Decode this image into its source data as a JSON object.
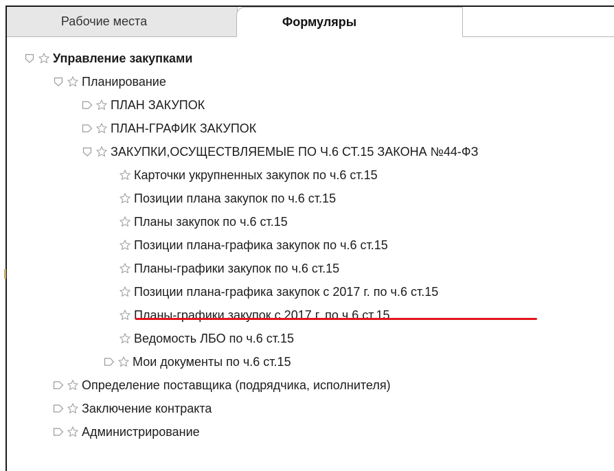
{
  "tabs": [
    {
      "label": "Рабочие места",
      "active": false
    },
    {
      "label": "Формуляры",
      "active": true
    }
  ],
  "tree": [
    {
      "label": "Управление закупками",
      "expanded": true,
      "bold": true,
      "toggle": "expanded"
    },
    {
      "label": "Планирование",
      "toggle": "expanded"
    },
    {
      "label": "ПЛАН ЗАКУПОК",
      "toggle": "collapsed"
    },
    {
      "label": "ПЛАН-ГРАФИК ЗАКУПОК",
      "toggle": "collapsed"
    },
    {
      "label": "ЗАКУПКИ,ОСУЩЕСТВЛЯЕМЫЕ ПО Ч.6 СТ.15 ЗАКОНА №44-ФЗ",
      "toggle": "expanded"
    },
    {
      "label": "Карточки укрупненных закупок по ч.6 ст.15",
      "toggle": "none"
    },
    {
      "label": "Позиции плана закупок по ч.6 ст.15",
      "toggle": "none"
    },
    {
      "label": "Планы закупок по ч.6 ст.15",
      "toggle": "none"
    },
    {
      "label": "Позиции плана-графика закупок по ч.6 ст.15",
      "toggle": "none"
    },
    {
      "label": "Планы-графики закупок по ч.6 ст.15",
      "toggle": "none"
    },
    {
      "label": "Позиции плана-графика закупок с 2017 г. по ч.6 ст.15",
      "toggle": "none",
      "highlighted": true
    },
    {
      "label": "Планы-графики закупок с 2017 г. по ч.6 ст.15",
      "toggle": "none"
    },
    {
      "label": "Ведомость ЛБО по ч.6 ст.15",
      "toggle": "none"
    },
    {
      "label": "Мои документы по ч.6 ст.15",
      "toggle": "collapsed"
    },
    {
      "label": "Определение поставщика (подрядчика, исполнителя)",
      "toggle": "collapsed"
    },
    {
      "label": "Заключение контракта",
      "toggle": "collapsed"
    },
    {
      "label": "Администрирование",
      "toggle": "collapsed"
    }
  ],
  "icons": {
    "toggle_expanded": "shield-down-icon",
    "toggle_collapsed": "arrow-tag-right-icon",
    "favorite": "star-outline-icon"
  },
  "colors": {
    "highlight_underline": "#e3141b",
    "tab_inactive_bg": "#e7e7e7",
    "icon_gray": "#9a9a9a"
  }
}
